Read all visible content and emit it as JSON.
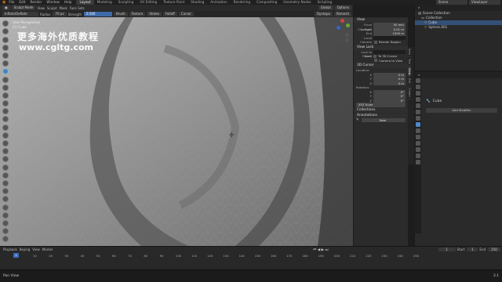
{
  "menu": [
    "File",
    "Edit",
    "Render",
    "Window",
    "Help"
  ],
  "workspaces": [
    {
      "label": "Layout",
      "active": true
    },
    {
      "label": "Modeling",
      "active": false
    },
    {
      "label": "Sculpting",
      "active": false
    },
    {
      "label": "UV Editing",
      "active": false
    },
    {
      "label": "Texture Paint",
      "active": false
    },
    {
      "label": "Shading",
      "active": false
    },
    {
      "label": "Animation",
      "active": false
    },
    {
      "label": "Rendering",
      "active": false
    },
    {
      "label": "Compositing",
      "active": false
    },
    {
      "label": "Geometry Nodes",
      "active": false
    },
    {
      "label": "Scripting",
      "active": false
    }
  ],
  "scene": {
    "scene_label": "Scene",
    "view_layer": "ViewLayer"
  },
  "header": {
    "mode": "Sculpt Mode",
    "view": "View",
    "sculpt": "Sculpt",
    "mask": "Mask",
    "face_sets": "Face Sets",
    "brush_name": "Inflate/Deflate",
    "radius_label": "Radius",
    "radius_value": "70 px",
    "strength_label": "Strength",
    "strength_value": "0.500",
    "brush": "Brush",
    "texture": "Texture",
    "stroke": "Stroke",
    "falloff": "Falloff",
    "cursor": "Cursor",
    "overlay": "Global",
    "options": "Options",
    "dyntopo": "Dyntopo",
    "remesh": "Remesh"
  },
  "viewport": {
    "info_line1": "User Perspective",
    "info_line2": "(1) Cube",
    "watermark_cn": "更多海外优质教程",
    "watermark_url": "www.cgltg.com"
  },
  "npanel": {
    "view_header": "View",
    "focal_label": "Focal Length",
    "focal_value": "50 mm",
    "clip_label": "Clip Start",
    "clip_value": "0.01 m",
    "end_label": "End",
    "end_value": "1000 m",
    "local_camera": "Local Camera",
    "render_region": "Render Region",
    "viewlock_header": "View Lock",
    "lock_to_object": "Lock to Object",
    "lock_label": "Lock",
    "to_3d_cursor": "To 3D Cursor",
    "camera_to_view": "Camera to View",
    "cursor_header": "3D Cursor",
    "location_label": "Location:",
    "loc": [
      {
        "axis": "X",
        "value": "0 m"
      },
      {
        "axis": "Y",
        "value": "0 m"
      },
      {
        "axis": "Z",
        "value": "0 m"
      }
    ],
    "rotation_label": "Rotation:",
    "rot": [
      {
        "axis": "X",
        "value": "0°"
      },
      {
        "axis": "Y",
        "value": "0°"
      },
      {
        "axis": "Z",
        "value": "0°"
      }
    ],
    "rot_mode": "XYZ Euler",
    "collections_header": "Collections",
    "annotations_header": "Annotations",
    "new_button": "New"
  },
  "ntabs": [
    "Item",
    "Tool",
    "View",
    "Edit",
    "Create"
  ],
  "outliner": {
    "root": "Scene Collection",
    "items": [
      {
        "name": "Collection",
        "selected": false
      },
      {
        "name": "Cube",
        "selected": true
      },
      {
        "name": "Sphere.001",
        "selected": false
      }
    ]
  },
  "properties": {
    "object_name": "Cube",
    "add_modifier": "Add Modifier"
  },
  "timeline": {
    "playback": "Playback",
    "keying": "Keying",
    "view": "View",
    "marker": "Marker",
    "current_frame": "1",
    "start_label": "Start",
    "start_value": "1",
    "end_label": "End",
    "end_value": "250",
    "ticks": [
      "10",
      "20",
      "30",
      "40",
      "50",
      "60",
      "70",
      "80",
      "90",
      "100",
      "110",
      "120",
      "130",
      "140",
      "150",
      "160",
      "170",
      "180",
      "190",
      "200",
      "210",
      "220",
      "230",
      "240",
      "250"
    ]
  },
  "status": {
    "left": "Pan View",
    "version": "3.1"
  }
}
